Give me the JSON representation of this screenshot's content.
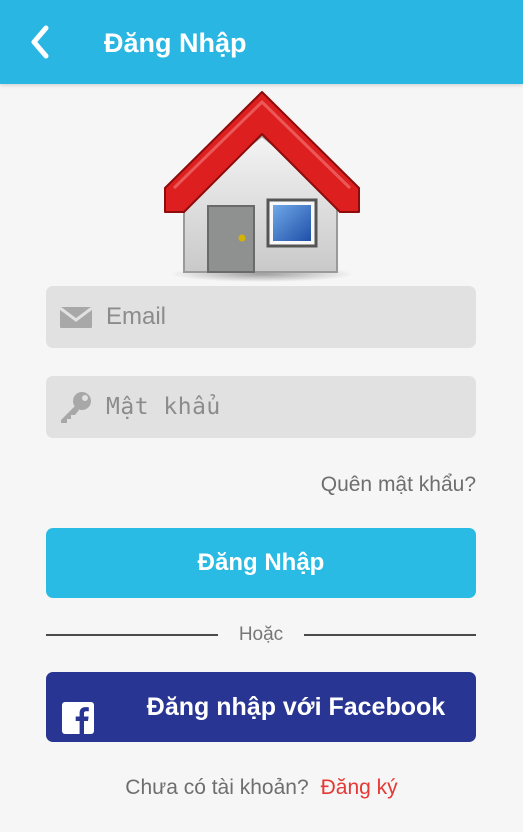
{
  "header": {
    "title": "Đăng Nhập",
    "back_icon": "back-arrow-icon"
  },
  "logo": {
    "icon": "house-logo-icon"
  },
  "form": {
    "email": {
      "placeholder": "Email",
      "value": "",
      "icon": "mail-icon"
    },
    "password": {
      "placeholder": "Mật khẩu",
      "value": "",
      "icon": "key-icon"
    },
    "forgot_label": "Quên mật khẩu?",
    "login_label": "Đăng Nhập"
  },
  "divider": {
    "label": "Hoặc"
  },
  "facebook": {
    "label": "Đăng nhập với Facebook",
    "icon": "facebook-icon"
  },
  "signup": {
    "question": "Chưa có tài khoản?",
    "link_label": "Đăng ký"
  },
  "colors": {
    "primary": "#29b6e3",
    "facebook": "#283593",
    "link_red": "#e53935",
    "background": "#f5f6f5"
  }
}
